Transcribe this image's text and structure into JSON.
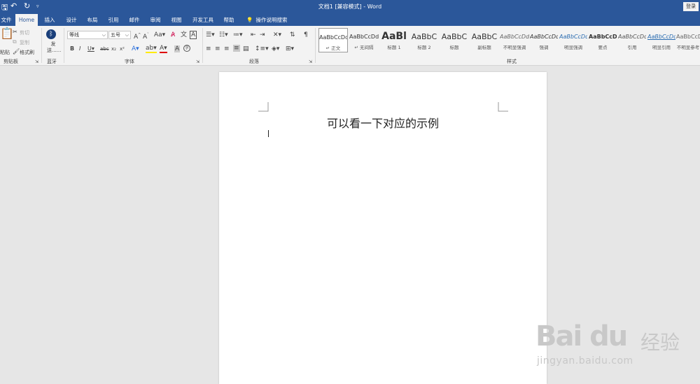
{
  "window": {
    "title": "文档1 [兼容模式] - Word",
    "login_label": "登录",
    "quick_access": [
      "save-icon",
      "undo-icon",
      "redo-icon",
      "customize-icon"
    ]
  },
  "tabs": [
    {
      "label": "文件",
      "active": false
    },
    {
      "label": "Home",
      "active": true
    },
    {
      "label": "插入",
      "active": false
    },
    {
      "label": "设计",
      "active": false
    },
    {
      "label": "布局",
      "active": false
    },
    {
      "label": "引用",
      "active": false
    },
    {
      "label": "邮件",
      "active": false
    },
    {
      "label": "审阅",
      "active": false
    },
    {
      "label": "视图",
      "active": false
    },
    {
      "label": "开发工具",
      "active": false
    },
    {
      "label": "帮助",
      "active": false
    }
  ],
  "tell_me": "操作说明搜索",
  "ribbon": {
    "clipboard": {
      "group": "剪贴板",
      "paste": "粘贴",
      "cut": "剪切",
      "copy": "复制",
      "format_painter": "格式刷"
    },
    "bluetooth": {
      "group": "蓝牙",
      "send": "发送......"
    },
    "font": {
      "group": "字体",
      "font_name": "等线",
      "font_size": "五号"
    },
    "paragraph": {
      "group": "段落"
    },
    "styles": {
      "group": "样式",
      "items": [
        {
          "sample": "AaBbCcDd",
          "name": "↵ 正文"
        },
        {
          "sample": "AaBbCcDd",
          "name": "↵ 无间隔"
        },
        {
          "sample": "AaBl",
          "name": "标题 1"
        },
        {
          "sample": "AaBbC",
          "name": "标题 2"
        },
        {
          "sample": "AaBbC",
          "name": "标题"
        },
        {
          "sample": "AaBbC",
          "name": "副标题"
        },
        {
          "sample": "AaBbCcDd",
          "name": "不明显强调"
        },
        {
          "sample": "AaBbCcDd",
          "name": "强调"
        },
        {
          "sample": "AaBbCcDd",
          "name": "明显强调"
        },
        {
          "sample": "AaBbCcDd",
          "name": "要点"
        },
        {
          "sample": "AaBbCcDd",
          "name": "引用"
        },
        {
          "sample": "AaBbCcDd",
          "name": "明显引用"
        },
        {
          "sample": "AaBbCcDd",
          "name": "不明显参考"
        }
      ]
    }
  },
  "document": {
    "text": "可以看一下对应的示例"
  },
  "watermark": {
    "main": "Bai du",
    "cn": "经验",
    "url": "jingyan.baidu.com"
  }
}
